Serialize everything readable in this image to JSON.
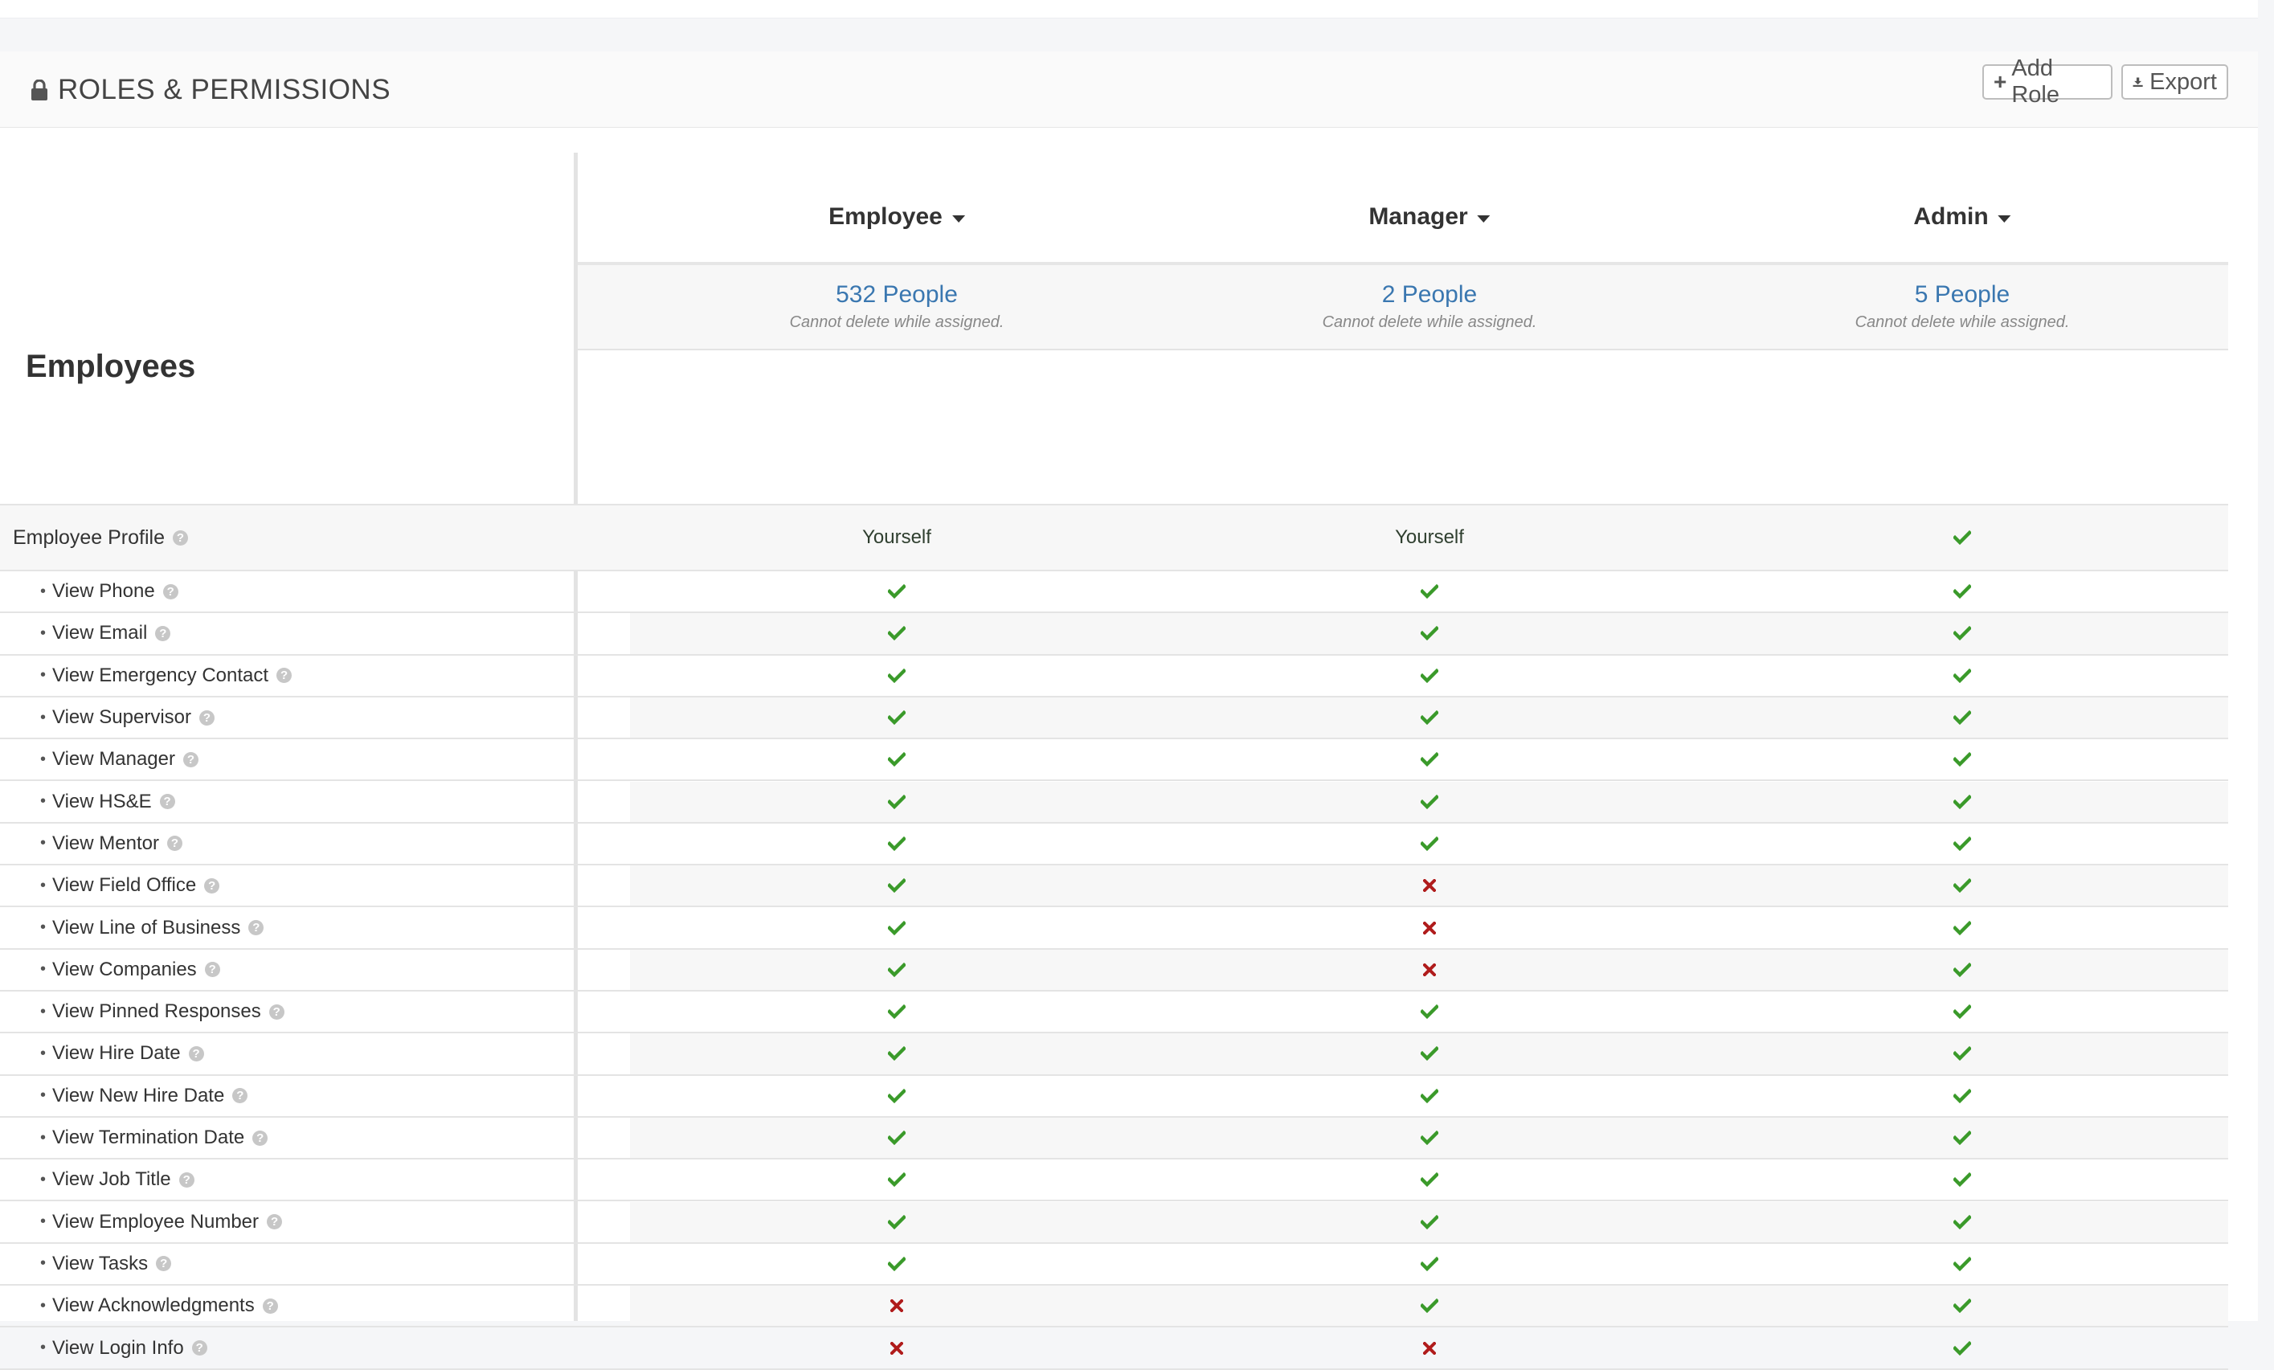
{
  "panel": {
    "title": "ROLES & PERMISSIONS",
    "buttons": {
      "add_role": "Add Role",
      "export": "Export"
    }
  },
  "section": {
    "title": "Employees"
  },
  "roles": [
    {
      "name": "Employee",
      "people": "532 People",
      "note": "Cannot delete while assigned."
    },
    {
      "name": "Manager",
      "people": "2 People",
      "note": "Cannot delete while assigned."
    },
    {
      "name": "Admin",
      "people": "5 People",
      "note": "Cannot delete while assigned."
    }
  ],
  "colors": {
    "check": "#3a9a2a",
    "cross": "#b01c1c",
    "link": "#3a77b0"
  },
  "permissions": [
    {
      "label": "Employee Profile",
      "main": true,
      "values": [
        "Yourself",
        "Yourself",
        "check"
      ]
    },
    {
      "label": "View Phone",
      "values": [
        "check",
        "check",
        "check"
      ]
    },
    {
      "label": "View Email",
      "values": [
        "check",
        "check",
        "check"
      ]
    },
    {
      "label": "View Emergency Contact",
      "values": [
        "check",
        "check",
        "check"
      ]
    },
    {
      "label": "View Supervisor",
      "values": [
        "check",
        "check",
        "check"
      ]
    },
    {
      "label": "View Manager",
      "values": [
        "check",
        "check",
        "check"
      ]
    },
    {
      "label": "View HS&E",
      "values": [
        "check",
        "check",
        "check"
      ]
    },
    {
      "label": "View Mentor",
      "values": [
        "check",
        "check",
        "check"
      ]
    },
    {
      "label": "View Field Office",
      "values": [
        "check",
        "cross",
        "check"
      ]
    },
    {
      "label": "View Line of Business",
      "values": [
        "check",
        "cross",
        "check"
      ]
    },
    {
      "label": "View Companies",
      "values": [
        "check",
        "cross",
        "check"
      ]
    },
    {
      "label": "View Pinned Responses",
      "values": [
        "check",
        "check",
        "check"
      ]
    },
    {
      "label": "View Hire Date",
      "values": [
        "check",
        "check",
        "check"
      ]
    },
    {
      "label": "View New Hire Date",
      "values": [
        "check",
        "check",
        "check"
      ]
    },
    {
      "label": "View Termination Date",
      "values": [
        "check",
        "check",
        "check"
      ]
    },
    {
      "label": "View Job Title",
      "values": [
        "check",
        "check",
        "check"
      ]
    },
    {
      "label": "View Employee Number",
      "values": [
        "check",
        "check",
        "check"
      ]
    },
    {
      "label": "View Tasks",
      "values": [
        "check",
        "check",
        "check"
      ]
    },
    {
      "label": "View Acknowledgments",
      "values": [
        "cross",
        "check",
        "check"
      ]
    },
    {
      "label": "View Login Info",
      "values": [
        "cross",
        "cross",
        "check"
      ]
    }
  ]
}
